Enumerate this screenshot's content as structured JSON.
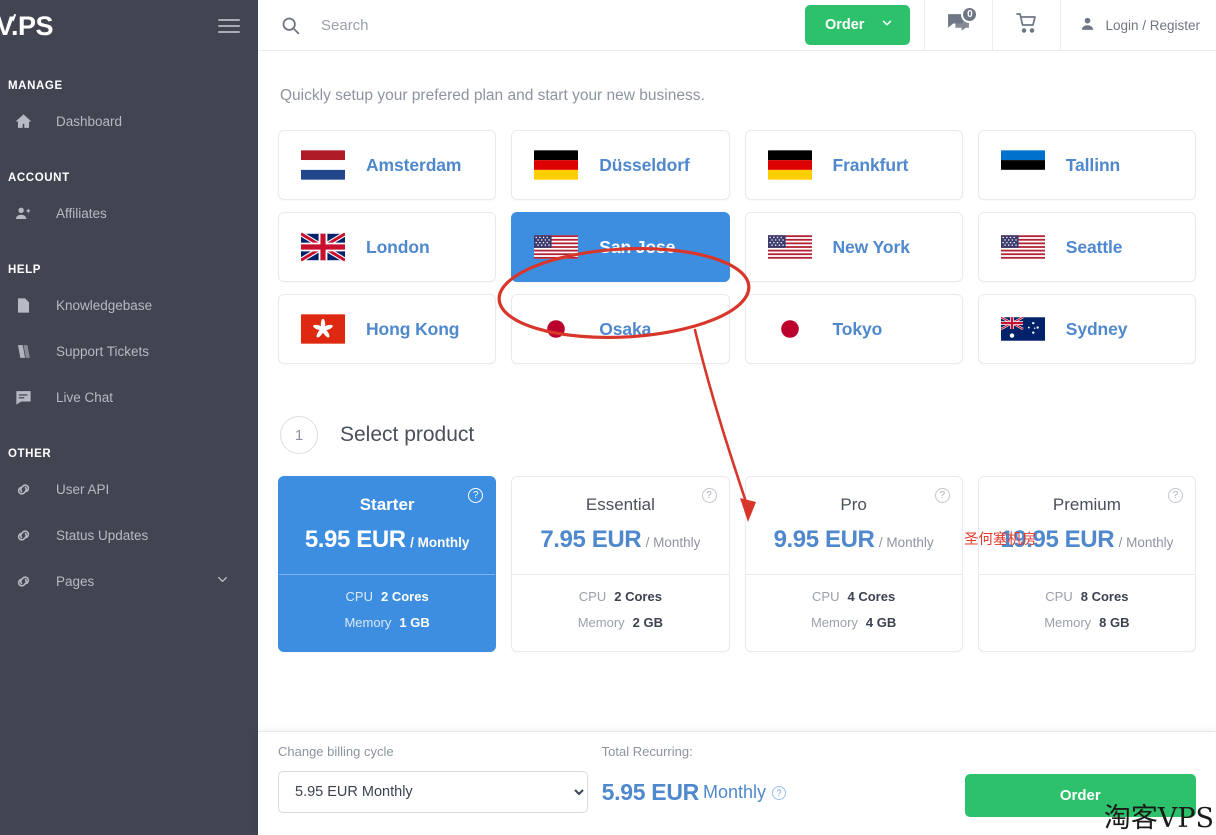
{
  "sidebar": {
    "logo": "V.PS",
    "menu_icon": "hamburger-icon",
    "sections": [
      {
        "title": "MANAGE",
        "items": [
          {
            "label": "Dashboard",
            "icon": "home-icon",
            "chevron": false
          }
        ]
      },
      {
        "title": "ACCOUNT",
        "items": [
          {
            "label": "Affiliates",
            "icon": "person-add-icon",
            "chevron": false
          }
        ]
      },
      {
        "title": "HELP",
        "items": [
          {
            "label": "Knowledgebase",
            "icon": "file-icon",
            "chevron": false
          },
          {
            "label": "Support Tickets",
            "icon": "ticket-icon",
            "chevron": false
          },
          {
            "label": "Live Chat",
            "icon": "chat-icon",
            "chevron": false
          }
        ]
      },
      {
        "title": "OTHER",
        "items": [
          {
            "label": "User API",
            "icon": "link-icon",
            "chevron": false
          },
          {
            "label": "Status Updates",
            "icon": "link-icon",
            "chevron": false
          },
          {
            "label": "Pages",
            "icon": "link-icon",
            "chevron": true
          }
        ]
      }
    ]
  },
  "header": {
    "search_icon": "search-icon",
    "search_placeholder": "Search",
    "search_value": "",
    "order_button": "Order",
    "order_caret": "chevron-down-icon",
    "notifications_icon": "chat-bubble-icon",
    "notifications_count": "0",
    "cart_icon": "shopping-cart-icon",
    "account_icon": "user-icon",
    "account_label": "Login / Register"
  },
  "main": {
    "subtitle": "Quickly setup your prefered plan and start your new business.",
    "locations": [
      {
        "name": "Amsterdam",
        "flag": "nl",
        "selected": false
      },
      {
        "name": "Düsseldorf",
        "flag": "de",
        "selected": false
      },
      {
        "name": "Frankfurt",
        "flag": "de",
        "selected": false
      },
      {
        "name": "Tallinn",
        "flag": "ee",
        "selected": false
      },
      {
        "name": "London",
        "flag": "gb",
        "selected": false
      },
      {
        "name": "San Jose",
        "flag": "us",
        "selected": true
      },
      {
        "name": "New York",
        "flag": "us",
        "selected": false
      },
      {
        "name": "Seattle",
        "flag": "us",
        "selected": false
      },
      {
        "name": "Hong Kong",
        "flag": "hk",
        "selected": false
      },
      {
        "name": "Osaka",
        "flag": "jp",
        "selected": false
      },
      {
        "name": "Tokyo",
        "flag": "jp",
        "selected": false
      },
      {
        "name": "Sydney",
        "flag": "au",
        "selected": false
      }
    ],
    "step": {
      "number": "1",
      "title": "Select product"
    },
    "spec_labels": {
      "cpu": "CPU",
      "memory": "Memory"
    },
    "products": [
      {
        "name": "Starter",
        "amount": "5.95 EUR",
        "cycle": "/ Monthly",
        "cpu": "2 Cores",
        "memory": "1 GB",
        "selected": true,
        "help": "?"
      },
      {
        "name": "Essential",
        "amount": "7.95 EUR",
        "cycle": "/ Monthly",
        "cpu": "2 Cores",
        "memory": "2 GB",
        "selected": false,
        "help": "?"
      },
      {
        "name": "Pro",
        "amount": "9.95 EUR",
        "cycle": "/ Monthly",
        "cpu": "4 Cores",
        "memory": "4 GB",
        "selected": false,
        "help": "?"
      },
      {
        "name": "Premium",
        "amount": "19.95 EUR",
        "cycle": "/ Monthly",
        "cpu": "8 Cores",
        "memory": "8 GB",
        "selected": false,
        "help": "?"
      }
    ]
  },
  "bottom_bar": {
    "billing_label": "Change billing cycle",
    "billing_selected": "5.95 EUR Monthly",
    "billing_options": [
      "5.95 EUR Monthly"
    ],
    "total_label": "Total Recurring:",
    "total_amount": "5.95 EUR",
    "total_cycle": "Monthly",
    "total_help": "?",
    "order_button": "Order"
  },
  "annotations": {
    "callout_text": "圣何塞机房",
    "highlight_target": "San Jose",
    "watermark": "淘客VPS"
  },
  "colors": {
    "sidebar_bg": "#414552",
    "accent_blue": "#3d8ee0",
    "link_blue": "#4f88cd",
    "green": "#2ec16b",
    "annotation_red": "#e23b2e"
  }
}
